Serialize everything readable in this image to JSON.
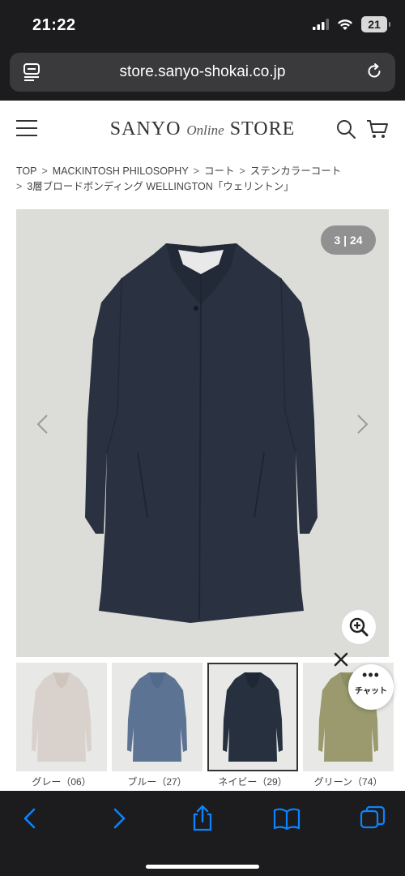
{
  "status_bar": {
    "time": "21:22",
    "battery": "21"
  },
  "browser": {
    "url": "store.sanyo-shokai.co.jp"
  },
  "header": {
    "logo_left": "SANYO",
    "logo_mid": "Online",
    "logo_right": "STORE"
  },
  "breadcrumb": {
    "items": [
      "TOP",
      "MACKINTOSH PHILOSOPHY",
      "コート",
      "ステンカラーコート",
      "3層ブロードボンディング WELLINGTON「ウェリントン」"
    ],
    "separator": ">"
  },
  "gallery": {
    "counter": "3 | 24",
    "colors": {
      "background": "#dcdcd9",
      "coat": "#2a3140"
    }
  },
  "thumbnails": [
    {
      "label": "グレー（06）",
      "color": "#d9d2cc"
    },
    {
      "label": "ブルー（27）",
      "color": "#5d7394"
    },
    {
      "label": "ネイビー（29）",
      "color": "#27303f",
      "selected": true
    },
    {
      "label": "グリーン（74）",
      "color": "#9a9a6e"
    }
  ],
  "chat": {
    "dots": "•••",
    "label": "チャット"
  },
  "toolbar": {
    "icons": [
      "back-icon",
      "forward-icon",
      "share-icon",
      "bookmarks-icon",
      "tabs-icon"
    ],
    "accent": "#0a84ff"
  }
}
